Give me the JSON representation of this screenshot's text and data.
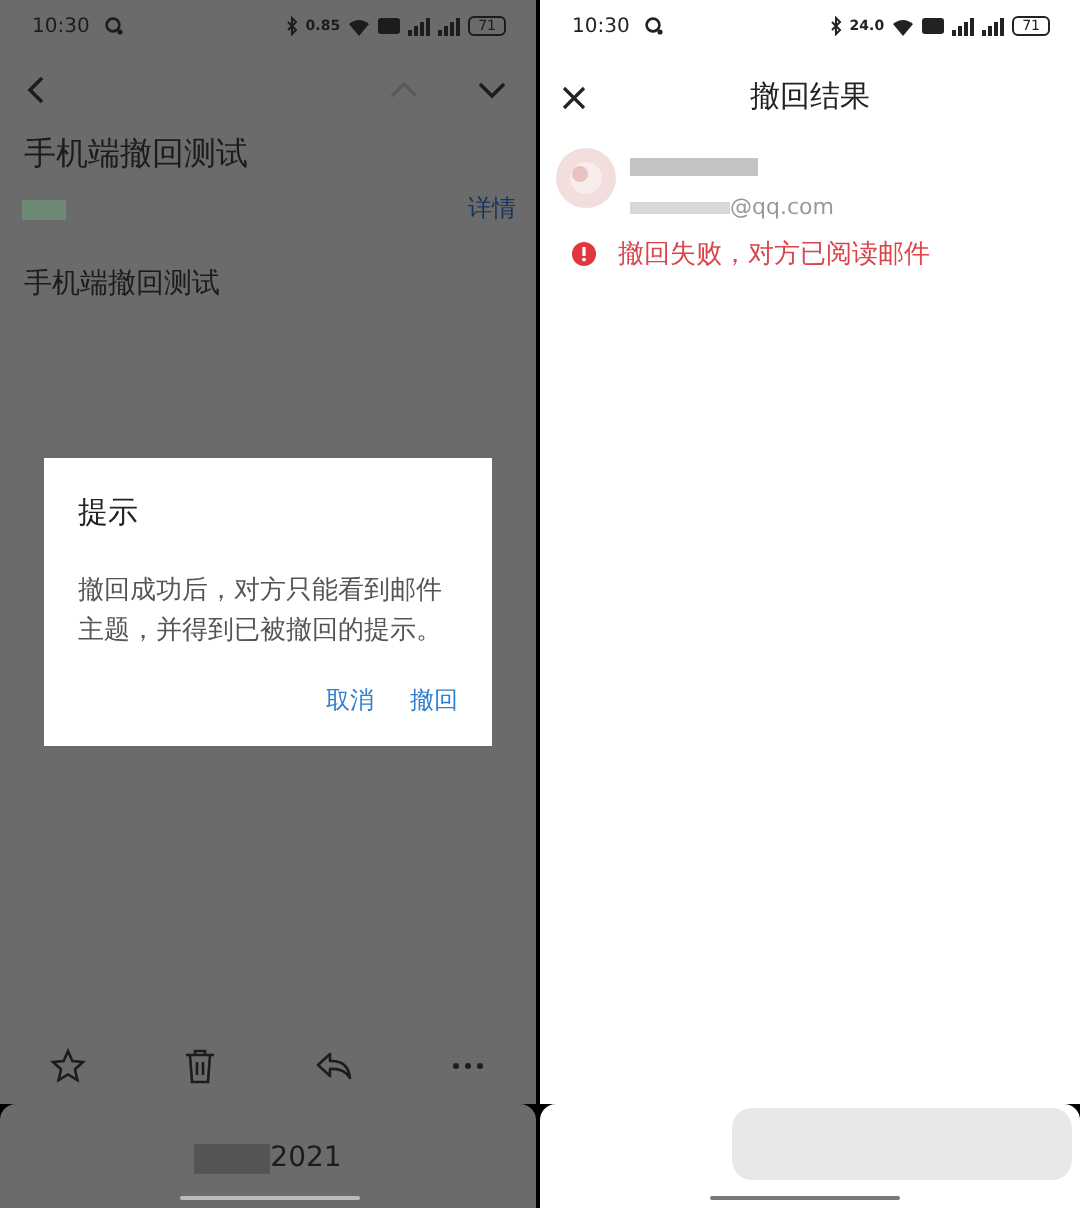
{
  "left_screen": {
    "status_bar": {
      "time": "10:30",
      "speed": "0.85",
      "battery": "71"
    },
    "nav_buttons": [
      {
        "kind": "back",
        "disabled": false
      },
      {
        "kind": "up",
        "disabled": true
      },
      {
        "kind": "down",
        "disabled": false
      }
    ],
    "email": {
      "subject": "手机端撤回测试",
      "details_link": "详情",
      "body": "手机端撤回测试"
    },
    "dialog": {
      "title": "提示",
      "message": "撤回成功后，对方只能看到邮件主题，并得到已被撤回的提示。",
      "buttons": [
        {
          "label": "取消"
        },
        {
          "label": "撤回"
        }
      ]
    },
    "toolbar": [
      {
        "kind": "star"
      },
      {
        "kind": "trash"
      },
      {
        "kind": "reply"
      },
      {
        "kind": "more"
      }
    ],
    "bottom_card": {
      "text": "2021"
    }
  },
  "right_screen": {
    "status_bar": {
      "time": "10:30",
      "speed": "24.0",
      "battery": "71"
    },
    "title": "撤回结果",
    "recipient": {
      "email_domain": "@qq.com",
      "failed": true,
      "status": "撤回失败，对方已阅读邮件"
    }
  }
}
